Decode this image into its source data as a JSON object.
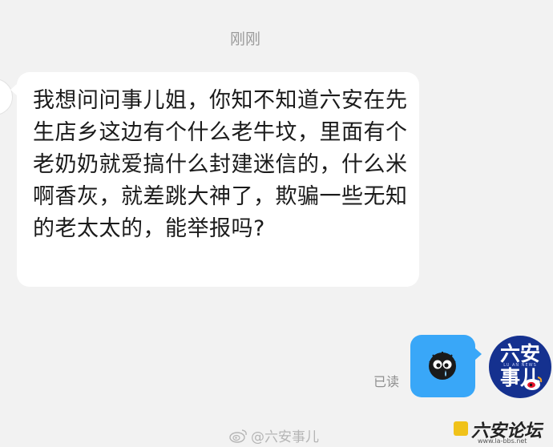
{
  "chat": {
    "timestamp": "刚刚",
    "incoming_message": "我想问问事儿姐，你知不知道六安在先生店乡这边有个什么老牛坟，里面有个老奶奶就爱搞什么封建迷信的，什么米啊香灰，就差跳大神了，欺骗一些无知的老太太的，能举报吗?",
    "read_status": "已读",
    "sticker": "crying-soot-sprite-sticker"
  },
  "avatar": {
    "line1": "六安",
    "line2": "事儿",
    "sub": "LU AN NEWS",
    "bg_color": "#15318f"
  },
  "watermark": {
    "handle": "@六安事儿"
  },
  "corner_logo": {
    "text": "六安论坛",
    "url": "www.la-bbs.net"
  },
  "colors": {
    "background": "#f2f2f2",
    "incoming_bubble": "#ffffff",
    "outgoing_bubble": "#39a7f8"
  }
}
